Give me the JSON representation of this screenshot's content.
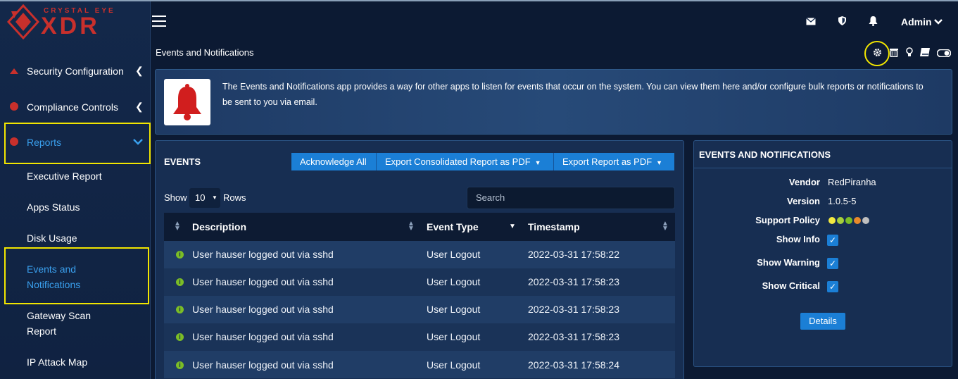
{
  "brand": {
    "tagline": "CRYSTAL EYE",
    "name": "XDR"
  },
  "header": {
    "user": "Admin",
    "icons": [
      "mail-icon",
      "shield-icon",
      "bell-icon"
    ]
  },
  "sidebar": {
    "items": [
      {
        "label": "Security Configuration"
      },
      {
        "label": "Compliance Controls"
      },
      {
        "label": "Reports"
      }
    ],
    "sub_items": [
      {
        "label": "Executive Report"
      },
      {
        "label": "Apps Status"
      },
      {
        "label": "Disk Usage"
      },
      {
        "label": "Events and Notifications"
      },
      {
        "label": "Gateway Scan Report"
      },
      {
        "label": "IP Attack Map"
      }
    ]
  },
  "page": {
    "title": "Events and Notifications",
    "description": "The Events and Notifications app provides a way for other apps to listen for events that occur on the system. You can view them here and/or configure bulk reports or notifications to be sent to you via email."
  },
  "events": {
    "heading": "EVENTS",
    "buttons": {
      "ack": "Acknowledge All",
      "export_consolidated": "Export Consolidated Report as PDF",
      "export": "Export Report as PDF"
    },
    "show_label": "Show",
    "rows_value": "10",
    "rows_label": "Rows",
    "search_placeholder": "Search",
    "columns": [
      "Description",
      "Event Type",
      "Timestamp"
    ],
    "rows": [
      {
        "description": "User hauser logged out via sshd",
        "type": "User Logout",
        "timestamp": "2022-03-31 17:58:22"
      },
      {
        "description": "User hauser logged out via sshd",
        "type": "User Logout",
        "timestamp": "2022-03-31 17:58:23"
      },
      {
        "description": "User hauser logged out via sshd",
        "type": "User Logout",
        "timestamp": "2022-03-31 17:58:23"
      },
      {
        "description": "User hauser logged out via sshd",
        "type": "User Logout",
        "timestamp": "2022-03-31 17:58:23"
      },
      {
        "description": "User hauser logged out via sshd",
        "type": "User Logout",
        "timestamp": "2022-03-31 17:58:24"
      }
    ]
  },
  "notifications": {
    "heading": "EVENTS AND NOTIFICATIONS",
    "vendor_label": "Vendor",
    "vendor": "RedPiranha",
    "version_label": "Version",
    "version": "1.0.5-5",
    "support_label": "Support Policy",
    "support_colors": [
      "#f3e940",
      "#a6cf3b",
      "#7bbd26",
      "#e9892a",
      "#bfbfbf"
    ],
    "show_info_label": "Show Info",
    "show_info": true,
    "show_warning_label": "Show Warning",
    "show_warning": true,
    "show_critical_label": "Show Critical",
    "show_critical": true,
    "details_button": "Details"
  },
  "colors": {
    "accent": "#1b7fd6",
    "highlight": "#f2e600",
    "brand": "#c8302c"
  }
}
